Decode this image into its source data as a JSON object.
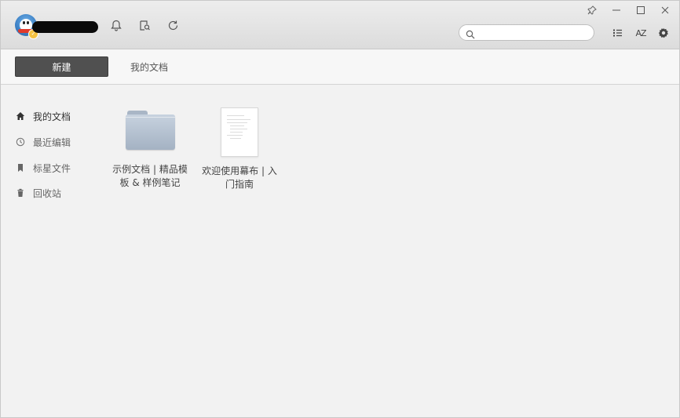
{
  "titlebar": {
    "icons": [
      "avatar",
      "bell-icon",
      "search-file-icon",
      "refresh-icon"
    ],
    "search": {
      "placeholder": "",
      "value": ""
    },
    "window_controls": [
      "pin-icon",
      "minimize-icon",
      "maximize-icon",
      "close-icon"
    ],
    "view_controls": {
      "list_icon": "list-view-icon",
      "sort_label": "AZ",
      "settings_icon": "gear-icon"
    }
  },
  "toolbar": {
    "new_label": "新建",
    "breadcrumb": "我的文档"
  },
  "sidebar": {
    "items": [
      {
        "label": "我的文档",
        "icon": "home-icon",
        "active": true
      },
      {
        "label": "最近编辑",
        "icon": "clock-icon",
        "active": false
      },
      {
        "label": "标星文件",
        "icon": "bookmark-icon",
        "active": false
      },
      {
        "label": "回收站",
        "icon": "trash-icon",
        "active": false
      }
    ]
  },
  "files": [
    {
      "type": "folder",
      "name": "示例文档 | 精品模板 & 样例笔记"
    },
    {
      "type": "document",
      "name": "欢迎使用幕布 | 入门指南"
    }
  ],
  "colors": {
    "new_button_bg": "#505050",
    "titlebar_bg": "#e4e4e4",
    "content_bg": "#f2f2f2",
    "folder": "#b4c1d1"
  }
}
